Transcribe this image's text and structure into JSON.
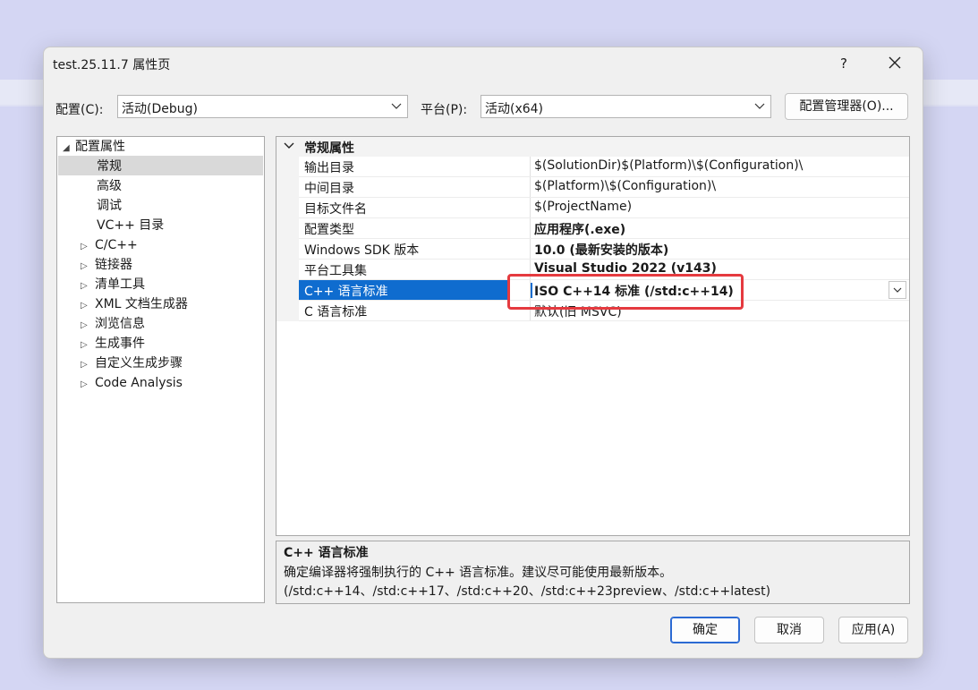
{
  "window": {
    "title": "test.25.11.7 属性页",
    "help_label": "?",
    "close_icon": "close-icon"
  },
  "config_bar": {
    "config_label": "配置(C):",
    "config_value": "活动(Debug)",
    "platform_label": "平台(P):",
    "platform_value": "活动(x64)",
    "manager_button": "配置管理器(O)..."
  },
  "tree": {
    "root": "配置属性",
    "items": [
      {
        "label": "常规",
        "selected": true,
        "expandable": false
      },
      {
        "label": "高级",
        "expandable": false
      },
      {
        "label": "调试",
        "expandable": false
      },
      {
        "label": "VC++ 目录",
        "expandable": false
      },
      {
        "label": "C/C++",
        "expandable": true
      },
      {
        "label": "链接器",
        "expandable": true
      },
      {
        "label": "清单工具",
        "expandable": true
      },
      {
        "label": "XML 文档生成器",
        "expandable": true
      },
      {
        "label": "浏览信息",
        "expandable": true
      },
      {
        "label": "生成事件",
        "expandable": true
      },
      {
        "label": "自定义生成步骤",
        "expandable": true
      },
      {
        "label": "Code Analysis",
        "expandable": true
      }
    ]
  },
  "grid": {
    "section_title": "常规属性",
    "rows": [
      {
        "name": "输出目录",
        "value": "$(SolutionDir)$(Platform)\\$(Configuration)\\",
        "bold": false
      },
      {
        "name": "中间目录",
        "value": "$(Platform)\\$(Configuration)\\",
        "bold": false
      },
      {
        "name": "目标文件名",
        "value": "$(ProjectName)",
        "bold": false
      },
      {
        "name": "配置类型",
        "value": "应用程序(.exe)",
        "bold": true
      },
      {
        "name": "Windows SDK 版本",
        "value": "10.0 (最新安装的版本)",
        "bold": true
      },
      {
        "name": "平台工具集",
        "value": "Visual Studio 2022 (v143)",
        "bold": true
      },
      {
        "name": "C++ 语言标准",
        "value": "ISO C++14 标准 (/std:c++14)",
        "bold": true,
        "selected": true
      },
      {
        "name": "C 语言标准",
        "value": "默认(旧 MSVC)",
        "bold": false
      }
    ],
    "highlight_color": "#e53a3f"
  },
  "description": {
    "title": "C++ 语言标准",
    "text": "确定编译器将强制执行的 C++ 语言标准。建议尽可能使用最新版本。(/std:c++14、/std:c++17、/std:c++20、/std:c++23preview、/std:c++latest)"
  },
  "buttons": {
    "ok": "确定",
    "cancel": "取消",
    "apply": "应用(A)"
  },
  "colors": {
    "accent": "#0f6ccf",
    "background": "#d4d6f3",
    "dialog": "#f0f0f0"
  }
}
